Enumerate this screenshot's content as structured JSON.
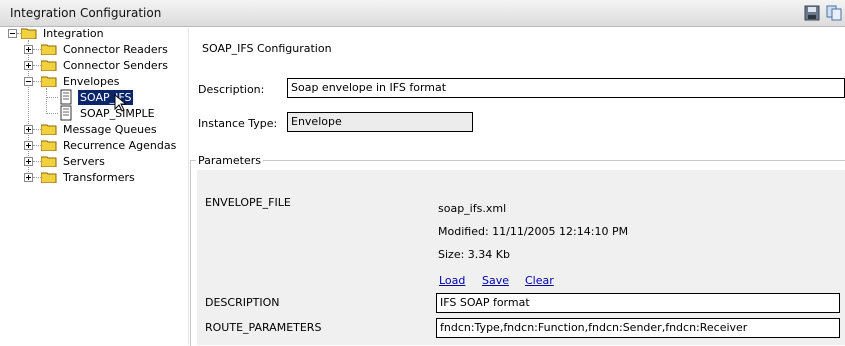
{
  "window": {
    "title": "Integration Configuration"
  },
  "toolbar": {
    "save_icon": "floppy-save-icon",
    "copy_icon": "copy-icon"
  },
  "tree": {
    "root": "Integration",
    "items": [
      {
        "label": "Connector Readers"
      },
      {
        "label": "Connector Senders"
      },
      {
        "label": "Envelopes",
        "children": [
          {
            "label": "SOAP_IFS"
          },
          {
            "label": "SOAP_SIMPLE"
          }
        ]
      },
      {
        "label": "Message Queues"
      },
      {
        "label": "Recurrence Agendas"
      },
      {
        "label": "Servers"
      },
      {
        "label": "Transformers"
      }
    ],
    "selected": "SOAP_IFS"
  },
  "config": {
    "title": "SOAP_IFS Configuration",
    "description_label": "Description:",
    "description_value": "Soap envelope in IFS format",
    "instance_type_label": "Instance Type:",
    "instance_type_value": "Envelope"
  },
  "parameters": {
    "legend": "Parameters",
    "envelope_file": {
      "label": "ENVELOPE_FILE",
      "filename": "soap_ifs.xml",
      "modified": "Modified: 11/11/2005 12:14:10 PM",
      "size": "Size: 3.34 Kb",
      "load": "Load",
      "save": "Save",
      "clear": "Clear"
    },
    "description": {
      "label": "DESCRIPTION",
      "value": "IFS SOAP format"
    },
    "route_parameters": {
      "label": "ROUTE_PARAMETERS",
      "value": "fndcn:Type,fndcn:Function,fndcn:Sender,fndcn:Receiver"
    }
  },
  "colors": {
    "selection": "#0a246a",
    "link": "#0000aa",
    "folder": "#f2d040"
  }
}
